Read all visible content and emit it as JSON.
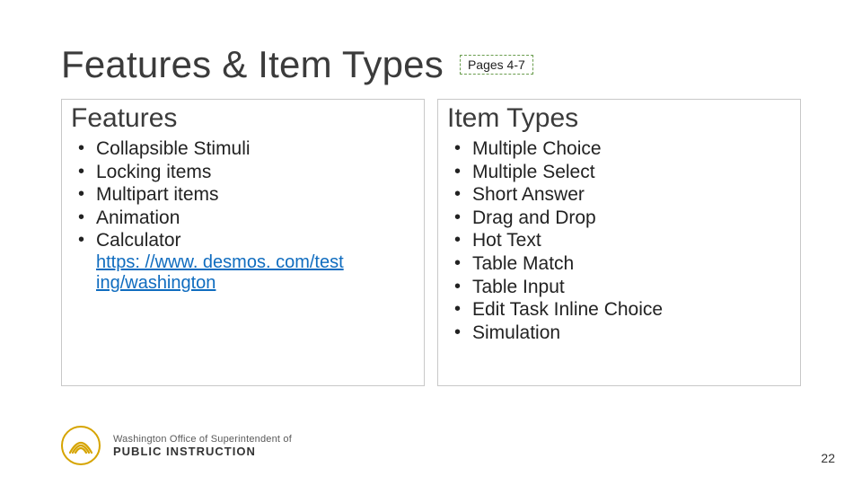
{
  "title": "Features & Item Types",
  "page_badge": "Pages 4-7",
  "columns": {
    "left": {
      "heading": "Features",
      "items": [
        "Collapsible Stimuli",
        "Locking items",
        "Multipart items",
        "Animation",
        "Calculator"
      ],
      "calculator_link_text": "https: //www. desmos. com/test ing/washington"
    },
    "right": {
      "heading": "Item Types",
      "items": [
        "Multiple Choice",
        "Multiple Select",
        "Short Answer",
        "Drag and Drop",
        "Hot Text",
        "Table Match",
        "Table Input",
        "Edit Task Inline Choice",
        "Simulation"
      ]
    }
  },
  "footer": {
    "agency_line1": "Washington Office of Superintendent of",
    "agency_line2": "PUBLIC INSTRUCTION"
  },
  "page_number": "22"
}
